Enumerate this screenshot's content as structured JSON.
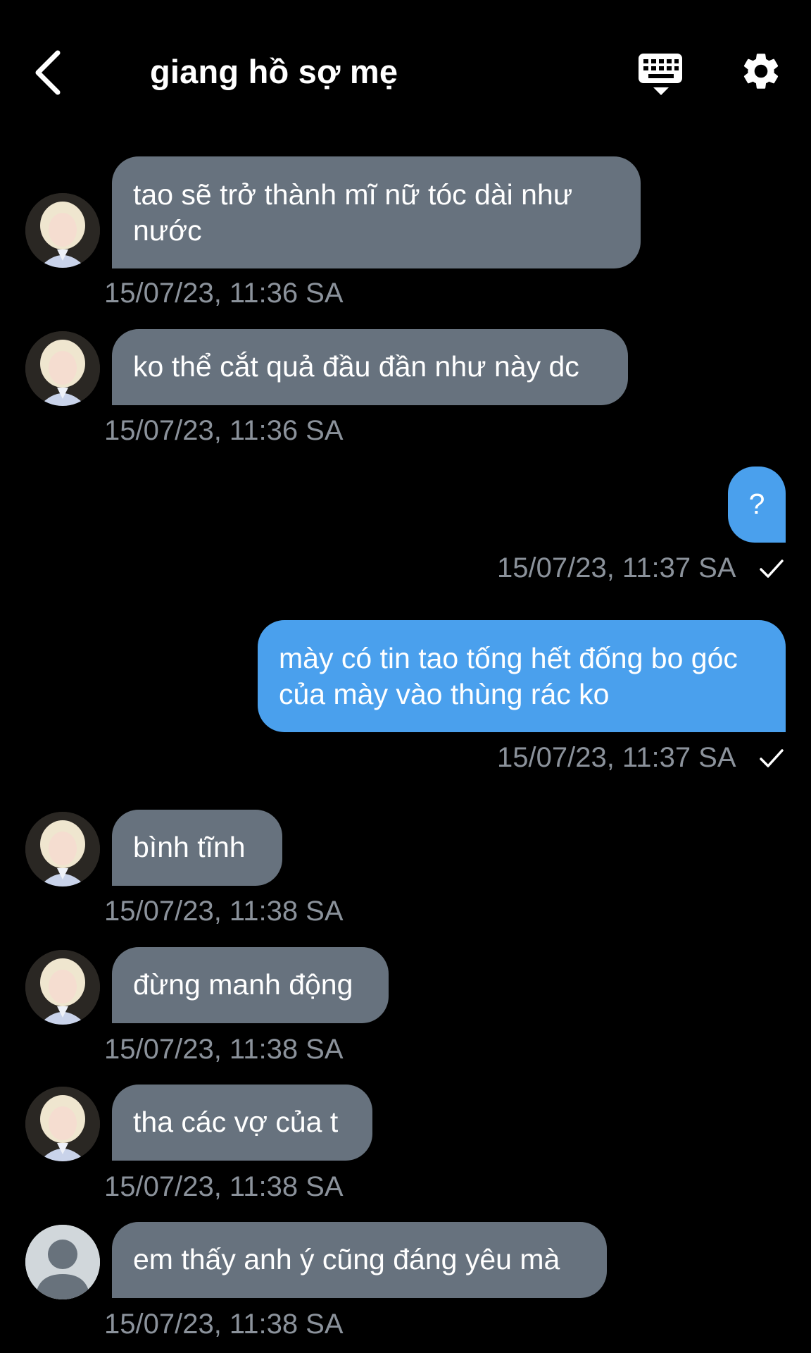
{
  "header": {
    "title": "giang hồ sợ mẹ",
    "back_icon": "chevron-left-icon",
    "keyboard_icon": "keyboard-hide-icon",
    "settings_icon": "gear-icon"
  },
  "colors": {
    "background": "#000000",
    "incoming_bubble": "#67727e",
    "outgoing_bubble": "#4aa0ed",
    "timestamp": "#8b929b"
  },
  "messages": [
    {
      "direction": "incoming",
      "avatar": "photo-avatar",
      "text": "tao sẽ trở thành mĩ nữ tóc dài như nước",
      "timestamp": "15/07/23, 11:36 SA"
    },
    {
      "direction": "incoming",
      "avatar": "photo-avatar",
      "text": "ko thể cắt quả đầu đần như này dc",
      "timestamp": "15/07/23, 11:36 SA"
    },
    {
      "direction": "outgoing",
      "text": "?",
      "timestamp": "15/07/23, 11:37 SA",
      "status_icon": "checkmark-icon"
    },
    {
      "direction": "outgoing",
      "text": "mày có tin tao tống hết đống bo góc của mày vào thùng rác ko",
      "timestamp": "15/07/23, 11:37 SA",
      "status_icon": "checkmark-icon"
    },
    {
      "direction": "incoming",
      "avatar": "photo-avatar",
      "text": "bình tĩnh",
      "timestamp": "15/07/23, 11:38 SA"
    },
    {
      "direction": "incoming",
      "avatar": "photo-avatar",
      "text": "đừng manh động",
      "timestamp": "15/07/23, 11:38 SA"
    },
    {
      "direction": "incoming",
      "avatar": "photo-avatar",
      "text": "tha các vợ của t",
      "timestamp": "15/07/23, 11:38 SA"
    },
    {
      "direction": "incoming",
      "avatar": "default-user-avatar",
      "text": "em thấy anh ý cũng đáng yêu mà",
      "timestamp": "15/07/23, 11:38 SA"
    }
  ]
}
